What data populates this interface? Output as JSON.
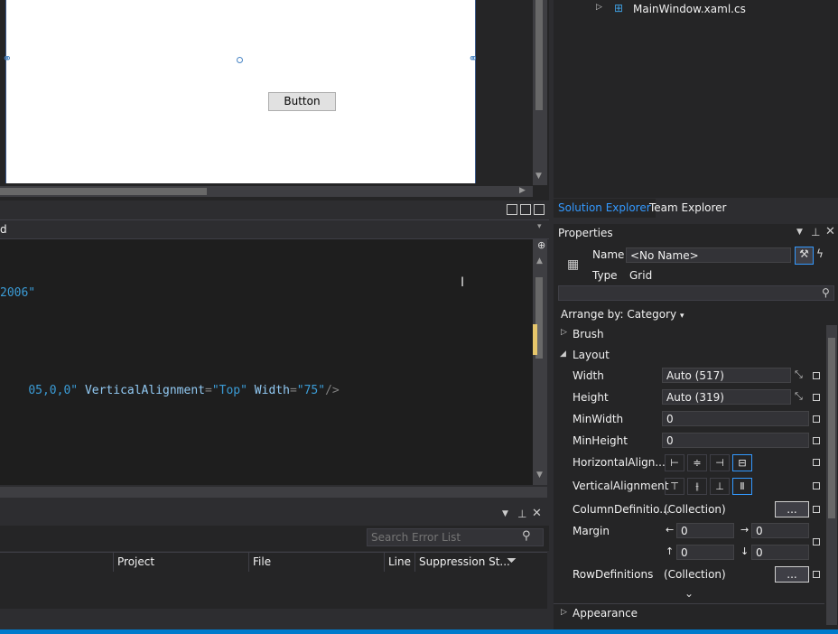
{
  "designer": {
    "button_label": "Button",
    "anchor_left_icon": "chain-link-icon",
    "anchor_right_icon": "chain-link-icon"
  },
  "xaml_bar": {
    "path_label": "d"
  },
  "editor": {
    "line1": "2006\"",
    "line2_a": "05,0,0\"",
    "line2_attr1": "VerticalAlignment",
    "line2_val1": "\"Top\"",
    "line2_attr2": "Width",
    "line2_val2": "\"75\"",
    "line2_end": "/>"
  },
  "error_list": {
    "search_placeholder": "Search Error List",
    "columns": [
      "Project",
      "File",
      "Line",
      "Suppression St..."
    ]
  },
  "solution_explorer": {
    "file_item": "MainWindow.xaml.cs",
    "tabs": [
      "Solution Explorer",
      "Team Explorer"
    ]
  },
  "properties": {
    "title": "Properties",
    "name_label": "Name",
    "name_value": "<No Name>",
    "type_label": "Type",
    "type_value": "Grid",
    "arrange_by": "Arrange by: Category",
    "categories": {
      "brush": "Brush",
      "layout": "Layout",
      "appearance": "Appearance"
    },
    "width_label": "Width",
    "width_value": "Auto (517)",
    "height_label": "Height",
    "height_value": "Auto (319)",
    "minwidth_label": "MinWidth",
    "minwidth_value": "0",
    "minheight_label": "MinHeight",
    "minheight_value": "0",
    "halign_label": "HorizontalAlign...",
    "valign_label": "VerticalAlignment",
    "coldefs_label": "ColumnDefinitio...",
    "coldefs_value": "(Collection)",
    "margin_label": "Margin",
    "margin_left": "0",
    "margin_right": "0",
    "margin_top": "0",
    "margin_bottom": "0",
    "rowdefs_label": "RowDefinitions",
    "rowdefs_value": "(Collection)",
    "ellipsis": "..."
  },
  "colors": {
    "accent": "#007acc",
    "selection": "#3399ff",
    "string": "#3b9cd6",
    "attribute": "#92caf4"
  }
}
